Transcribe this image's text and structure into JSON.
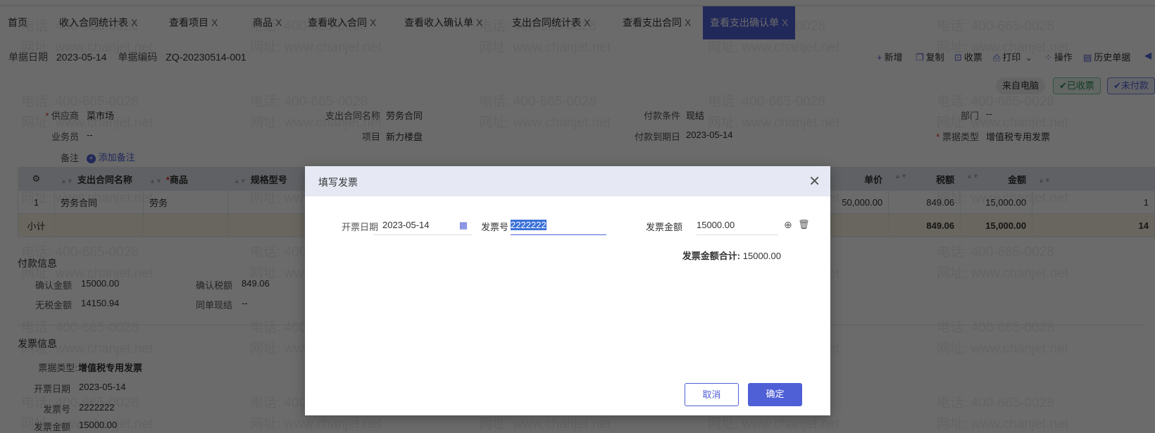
{
  "tabs": [
    {
      "label": "首页",
      "closable": false
    },
    {
      "label": "收入合同统计表",
      "closable": true
    },
    {
      "label": "查看项目",
      "closable": true
    },
    {
      "label": "商品",
      "closable": true
    },
    {
      "label": "查看收入合同",
      "closable": true
    },
    {
      "label": "查看收入确认单",
      "closable": true
    },
    {
      "label": "支出合同统计表",
      "closable": true
    },
    {
      "label": "查看支出合同",
      "closable": true
    },
    {
      "label": "查看支出确认单",
      "closable": true,
      "active": true
    }
  ],
  "close_glyph": "X",
  "header": {
    "date_label": "单据日期",
    "date": "2023-05-14",
    "code_label": "单据编码",
    "code": "ZQ-20230514-001"
  },
  "toolbar": {
    "new": "新增",
    "copy": "复制",
    "receive": "收票",
    "print": "打印",
    "operate": "操作",
    "history": "历史单据"
  },
  "badges": {
    "source": "来自电脑",
    "received": "已收票",
    "unpaid": "未付款"
  },
  "form": {
    "supplier_label": "供应商",
    "supplier": "菜市场",
    "contract_label": "支出合同名称",
    "contract": "劳务合同",
    "terms_label": "付款条件",
    "terms": "现结",
    "dept_label": "部门",
    "dept": "--",
    "staff_label": "业务员",
    "staff": "--",
    "project_label": "项目",
    "project": "新力楼盘",
    "due_label": "付款到期日",
    "due": "2023-05-14",
    "invoice_type_label": "票据类型",
    "invoice_type": "增值税专用发票",
    "note_label": "备注",
    "add_note": "添加备注"
  },
  "table": {
    "headers": [
      "支出合同名称",
      "商品",
      "规格型号",
      "单价",
      "税额",
      "金额"
    ],
    "row": {
      "index": "1",
      "contract": "劳务合同",
      "goods": "劳务",
      "price": "50,000.00",
      "tax": "849.06",
      "amount": "15,000.00",
      "extra": "1"
    },
    "subtotal": {
      "label": "小计",
      "tax": "849.06",
      "amount": "15,000.00",
      "extra": "14"
    }
  },
  "payment": {
    "title": "付款信息",
    "confirm_amount_label": "确认金额",
    "confirm_amount": "15000.00",
    "confirm_tax_label": "确认税额",
    "confirm_tax": "849.06",
    "net_label": "无税金额",
    "net": "14150.94",
    "cash_label": "同单现结",
    "cash": "--"
  },
  "invoice": {
    "title": "发票信息",
    "type_label": "票据类型:",
    "type": "增值税专用发票",
    "date_label": "开票日期",
    "date": "2023-05-14",
    "no_label": "发票号",
    "no": "2222222",
    "amount_label": "发票金额",
    "amount": "15000.00"
  },
  "modal": {
    "title": "填写发票",
    "date_label": "开票日期",
    "date": "2023-05-14",
    "no_label": "发票号",
    "no": "2222222",
    "amount_label": "发票金额",
    "amount": "15000.00",
    "total_label": "发票金额合计:",
    "total": "15000.00",
    "cancel": "取消",
    "ok": "确定"
  },
  "watermark": {
    "phone": "电话: 400-665-0028",
    "site": "网址: www.chanjet.net"
  },
  "colors": {
    "accent": "#4f5fd6",
    "green": "#3aa56a"
  }
}
